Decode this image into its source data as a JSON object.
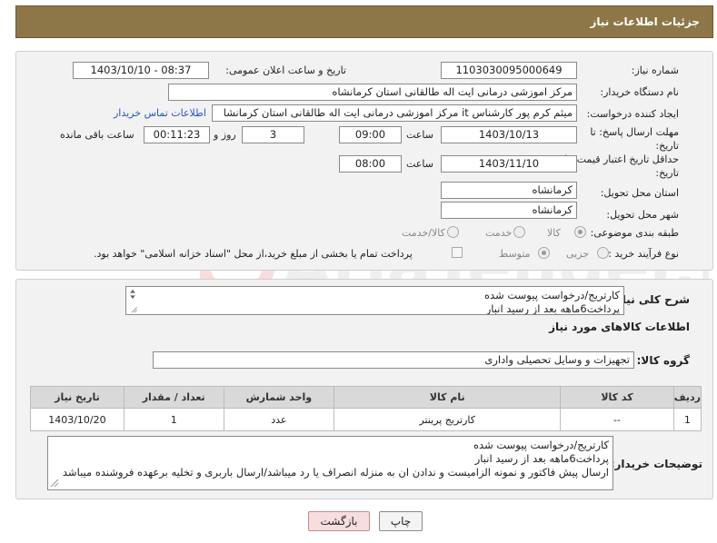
{
  "header": {
    "title": "جزئیات اطلاعات نیاز"
  },
  "form": {
    "need_number_label": "شماره نیاز:",
    "need_number": "1103030095000649",
    "announce_label": "تاریخ و ساعت اعلان عمومی:",
    "announce_value": "1403/10/10 - 08:37",
    "buyer_org_label": "نام دستگاه خریدار:",
    "buyer_org": "مرکز اموزشی درمانی ایت اله طالقانی استان کرمانشاه",
    "creator_label": "ایجاد کننده درخواست:",
    "creator": "میثم کرم پور کارشناس it مرکز اموزشی درمانی ایت اله طالقانی استان کرمانشا",
    "contact_link": "اطلاعات تماس خریدار",
    "reply_deadline_label": "مهلت ارسال پاسخ: تا تاریخ:",
    "reply_date": "1403/10/13",
    "time_label": "ساعت",
    "reply_time": "09:00",
    "days_value": "3",
    "days_label": "روز و",
    "remaining_time": "00:11:23",
    "remaining_label": "ساعت باقی مانده",
    "validity_label": "حداقل تاریخ اعتبار قیمت: تا تاریخ:",
    "validity_date": "1403/11/10",
    "validity_time_label": "ساعت",
    "validity_time": "08:00",
    "province_label": "استان محل تحویل:",
    "province": "کرمانشاه",
    "city_label": "شهر محل تحویل:",
    "city": "کرمانشاه",
    "category_label": "طبقه بندی موضوعی:",
    "category_options": [
      "کالا",
      "خدمت",
      "کالا/خدمت"
    ],
    "process_label": "نوع فرآیند خرید :",
    "process_options": [
      "جزیی",
      "متوسط"
    ],
    "payment_note": "پرداخت تمام یا بخشی از مبلغ خرید،از محل \"اسناد خزانه اسلامی\" خواهد بود."
  },
  "description": {
    "label": "شرح کلی نیاز:",
    "line1": "کارتریج/درخواست پیوست شده",
    "line2": "پرداخت6ماهه بعد از رسید انبار"
  },
  "goods_section": {
    "title": "اطلاعات کالاهای مورد نیاز",
    "group_label": "گروه کالا:",
    "group_value": "تجهیزات و وسایل تحصیلی واداری"
  },
  "table": {
    "headers": [
      "ردیف",
      "کد کالا",
      "نام کالا",
      "واحد شمارش",
      "تعداد / مقدار",
      "تاریخ نیاز"
    ],
    "rows": [
      [
        "1",
        "--",
        "کارتریج پرینتر",
        "عدد",
        "1",
        "1403/10/20"
      ]
    ]
  },
  "buyer_notes": {
    "label": "توضیحات خریدار:",
    "line1": "کارتریج/درخواست پیوست شده",
    "line2": "پرداخت6ماهه بعد از رسید انبار",
    "line3": "ارسال پیش فاکتور و نمونه الزامیست  و ندادن ان به منزله انصراف یا رد میباشد/ارسال باربری و تخلیه برعهده فروشنده میباشد"
  },
  "buttons": {
    "print": "چاپ",
    "back": "بازگشت"
  },
  "watermark_text": "AriaTender.neT",
  "colors": {
    "header_bg": "#8d7748",
    "link": "#2a55b8",
    "back_btn": "#f7dede"
  }
}
